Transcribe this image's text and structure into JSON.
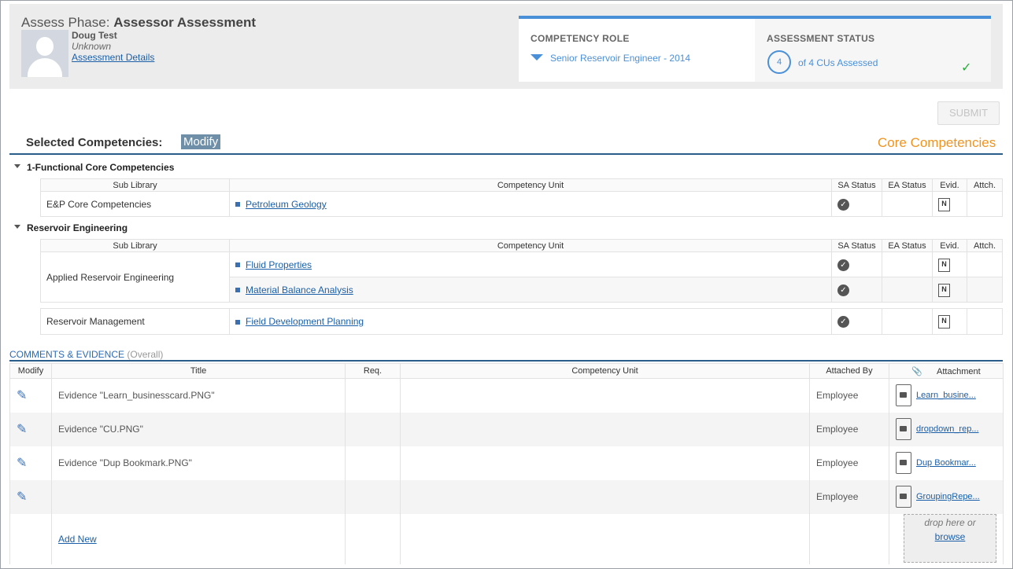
{
  "header": {
    "phase_label": "Assess Phase:",
    "phase_title": "Assessor Assessment",
    "user_name": "Doug Test",
    "user_role": "Unknown",
    "details_link": "Assessment Details",
    "competency_role_title": "COMPETENCY ROLE",
    "competency_role_value": "Senior Reservoir Engineer - 2014",
    "assessment_status_title": "ASSESSMENT STATUS",
    "assessed_count": "4",
    "assessed_text": "of 4 CUs Assessed"
  },
  "toolbar": {
    "submit_label": "SUBMIT"
  },
  "selected": {
    "label": "Selected Competencies:",
    "modify_label": "Modify",
    "core_label": "Core Competencies"
  },
  "columns": {
    "sub_library": "Sub Library",
    "competency_unit": "Competency Unit",
    "sa_status": "SA Status",
    "ea_status": "EA Status",
    "evid": "Evid.",
    "attch": "Attch."
  },
  "groups": [
    {
      "name": "1-Functional Core Competencies",
      "rows": [
        {
          "sub_library": "E&P Core Competencies",
          "unit": "Petroleum Geology"
        }
      ]
    },
    {
      "name": "Reservoir Engineering",
      "rows": [
        {
          "sub_library": "Applied Reservoir Engineering",
          "unit": "Fluid Properties"
        },
        {
          "sub_library": "",
          "unit": "Material Balance Analysis"
        },
        {
          "sub_library": "Reservoir Management",
          "unit": "Field Development Planning"
        }
      ]
    }
  ],
  "comments": {
    "title": "COMMENTS & EVIDENCE",
    "subtitle": "(Overall)",
    "columns": {
      "modify": "Modify",
      "title": "Title",
      "req": "Req.",
      "competency_unit": "Competency Unit",
      "attached_by": "Attached By",
      "attachment": "Attachment"
    },
    "rows": [
      {
        "title": "Evidence \"Learn_businesscard.PNG\"",
        "attached_by": "Employee",
        "attachment": "Learn_busine..."
      },
      {
        "title": "Evidence \"CU.PNG\"",
        "attached_by": "Employee",
        "attachment": "dropdown_rep..."
      },
      {
        "title": "Evidence \"Dup Bookmark.PNG\"",
        "attached_by": "Employee",
        "attachment": "Dup Bookmar..."
      },
      {
        "title": "",
        "attached_by": "Employee",
        "attachment": "GroupingRepe..."
      }
    ],
    "add_new": "Add New",
    "drop_text": "drop here or",
    "browse": "browse"
  }
}
